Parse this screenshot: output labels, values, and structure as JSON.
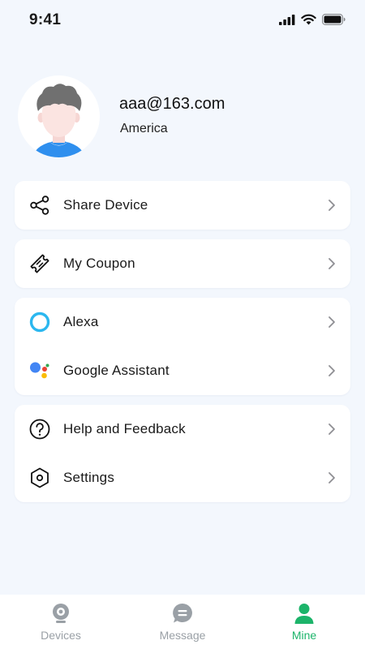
{
  "status_bar": {
    "time": "9:41"
  },
  "profile": {
    "email": "aaa@163.com",
    "region": "America"
  },
  "menu": {
    "share_device": "Share Device",
    "my_coupon": "My Coupon",
    "alexa": "Alexa",
    "google_assistant": "Google Assistant",
    "help_feedback": "Help and Feedback",
    "settings": "Settings"
  },
  "icons": {
    "share_device": "share-icon",
    "my_coupon": "coupon-icon",
    "alexa": "alexa-icon",
    "google_assistant": "google-assistant-icon",
    "help_feedback": "help-icon",
    "settings": "settings-hexagon-icon",
    "chevron": "chevron-right-icon"
  },
  "tabs": {
    "devices": "Devices",
    "message": "Message",
    "mine": "Mine",
    "active": "mine"
  },
  "colors": {
    "background": "#f3f7fd",
    "accent_green": "#1cb46a",
    "inactive_tab": "#9aa0a6",
    "alexa_blue": "#2bb7ef",
    "avatar_shirt": "#2f8fee",
    "avatar_hair": "#707070"
  }
}
